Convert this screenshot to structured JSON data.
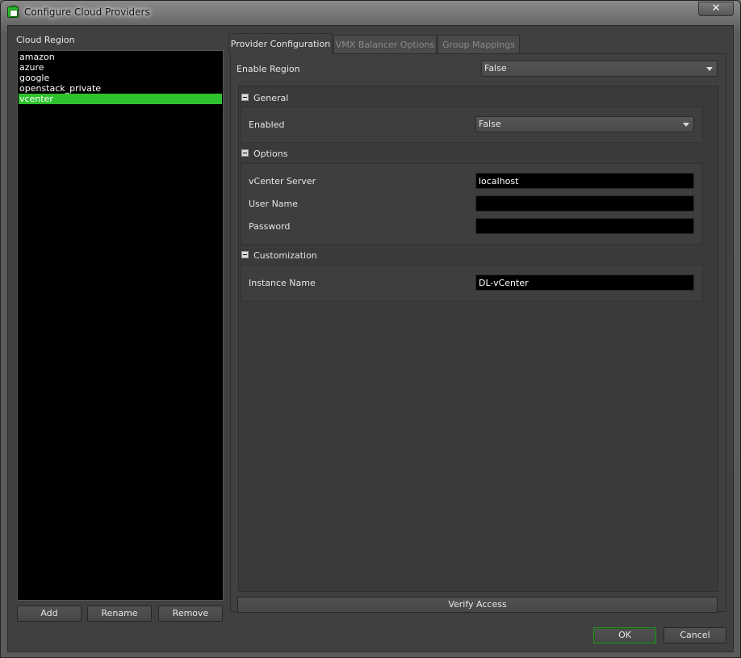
{
  "window": {
    "title": "Configure Cloud Providers",
    "close_label": "✕"
  },
  "cloud_region": {
    "label": "Cloud Region",
    "items": [
      "amazon",
      "azure",
      "google",
      "openstack_private",
      "vcenter"
    ],
    "selected": "vcenter",
    "buttons": {
      "add": "Add",
      "rename": "Rename",
      "remove": "Remove"
    }
  },
  "tabs": [
    "Provider Configuration",
    "VMX Balancer Options",
    "Group Mappings"
  ],
  "active_tab": "Provider Configuration",
  "provider": {
    "enable_region": {
      "label": "Enable Region",
      "value": "False"
    },
    "sections": {
      "general": {
        "title": "General",
        "enabled": {
          "label": "Enabled",
          "value": "False"
        }
      },
      "options": {
        "title": "Options",
        "vcenter_server": {
          "label": "vCenter Server",
          "value": "localhost"
        },
        "user_name": {
          "label": "User Name",
          "value": ""
        },
        "password": {
          "label": "Password",
          "value": ""
        }
      },
      "customization": {
        "title": "Customization",
        "instance_name": {
          "label": "Instance Name",
          "value": "DL-vCenter"
        }
      }
    },
    "verify_access": "Verify Access"
  },
  "footer": {
    "ok": "OK",
    "cancel": "Cancel"
  },
  "colors": {
    "selection": "#2ec22e",
    "background": "#404040",
    "list_background": "#000000"
  }
}
